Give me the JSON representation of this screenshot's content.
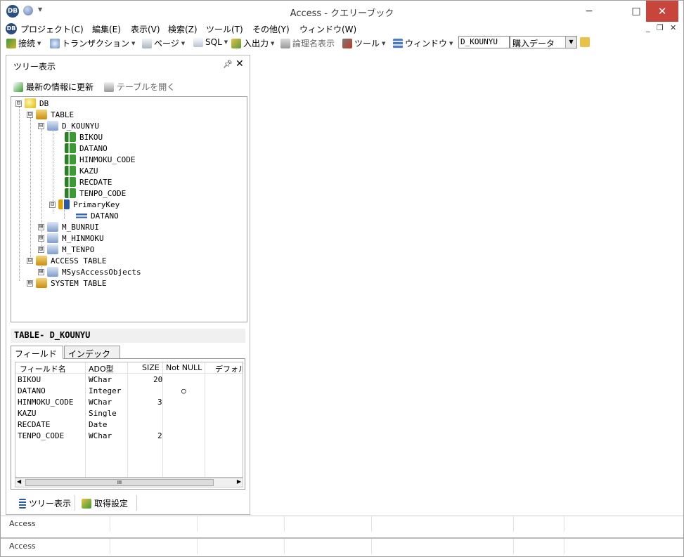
{
  "window": {
    "title": "Access - クエリーブック",
    "app_icon_text": "DB",
    "min": "−",
    "max": "□",
    "close": "✕"
  },
  "menu": [
    "プロジェクト(C)",
    "編集(E)",
    "表示(V)",
    "検索(Z)",
    "ツール(T)",
    "その他(Y)",
    "ウィンドウ(W)"
  ],
  "mdi": {
    "min": "_",
    "restore": "❐",
    "close": "✕"
  },
  "toolbar": {
    "items": [
      "接続",
      "トランザクション",
      "ページ",
      "SQL",
      "入出力",
      "論理名表示",
      "ツール",
      "ウィンドウ"
    ],
    "table_combo": "D_KOUNYU",
    "name_combo": "購入データ"
  },
  "panel": {
    "title": "ツリー表示",
    "pin": "ᵖ",
    "close": "✕",
    "refresh": "最新の情報に更新",
    "open_table": "テーブルを開く"
  },
  "tree": [
    {
      "label": "DB",
      "toggle": "⊟"
    },
    {
      "label": "TABLE",
      "toggle": "⊟"
    },
    {
      "label": "D_KOUNYU",
      "toggle": "⊟"
    },
    {
      "label": "BIKOU",
      "toggle": ""
    },
    {
      "label": "DATANO",
      "toggle": ""
    },
    {
      "label": "HINMOKU_CODE",
      "toggle": ""
    },
    {
      "label": "KAZU",
      "toggle": ""
    },
    {
      "label": "RECDATE",
      "toggle": ""
    },
    {
      "label": "TENPO_CODE",
      "toggle": ""
    },
    {
      "label": "PrimaryKey",
      "toggle": "⊟"
    },
    {
      "label": "DATANO",
      "toggle": ""
    },
    {
      "label": "M_BUNRUI",
      "toggle": "⊞"
    },
    {
      "label": "M_HINMOKU",
      "toggle": "⊞"
    },
    {
      "label": "M_TENPO",
      "toggle": "⊞"
    },
    {
      "label": "ACCESS TABLE",
      "toggle": "⊟"
    },
    {
      "label": "MSysAccessObjects",
      "toggle": "⊞"
    },
    {
      "label": "SYSTEM TABLE",
      "toggle": "⊞"
    }
  ],
  "props": {
    "title": "TABLE- D_KOUNYU",
    "tabs": [
      "フィールド",
      "インデックス"
    ]
  },
  "grid": {
    "headers": [
      "フィールド名",
      "ADO型",
      "SIZE",
      "Not NULL",
      "デフォル"
    ],
    "rows": [
      [
        "BIKOU",
        "WChar",
        "20",
        ""
      ],
      [
        "DATANO",
        "Integer",
        "",
        "○"
      ],
      [
        "HINMOKU_CODE",
        "WChar",
        "3",
        ""
      ],
      [
        "KAZU",
        "Single",
        "",
        ""
      ],
      [
        "RECDATE",
        "Date",
        "",
        ""
      ],
      [
        "TENPO_CODE",
        "WChar",
        "2",
        ""
      ]
    ],
    "thumb": "III"
  },
  "bottom_tabs": [
    "ツリー表示",
    "取得設定"
  ],
  "status": [
    "Access",
    "Access"
  ]
}
